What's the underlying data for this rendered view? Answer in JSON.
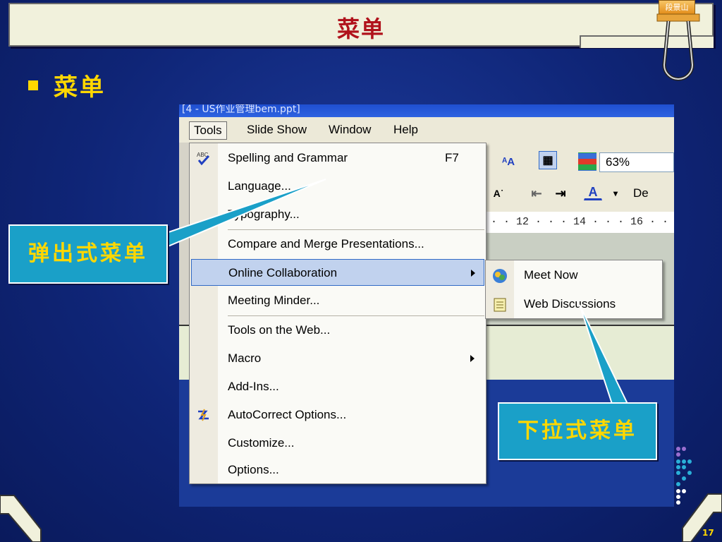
{
  "slide": {
    "title": "菜单",
    "badge": "段景山",
    "bullet": "菜单",
    "page_number": "17"
  },
  "callouts": {
    "popup": "弹出式菜单",
    "dropdown": "下拉式菜单"
  },
  "screenshot": {
    "window_title": "[4 - US作业管理bem.ppt]",
    "menubar": [
      "Tools",
      "Slide Show",
      "Window",
      "Help"
    ],
    "active_menu": "Tools",
    "zoom": "63%",
    "design_label": "De",
    "ruler_text": "· · 12 · · · 14 · · · 16 · · ·",
    "tools_menu": [
      {
        "label": "Spelling and Grammar",
        "shortcut": "F7",
        "icon": "spellcheck-icon"
      },
      {
        "label": "Language...",
        "shortcut": "",
        "icon": ""
      },
      {
        "label": "Typography...",
        "shortcut": "",
        "icon": ""
      },
      {
        "label": "Compare and Merge Presentations...",
        "shortcut": "",
        "icon": ""
      },
      {
        "label": "Online Collaboration",
        "shortcut": "",
        "icon": "",
        "submenu": true
      },
      {
        "label": "Meeting Minder...",
        "shortcut": "",
        "icon": ""
      },
      {
        "label": "Tools on the Web...",
        "shortcut": "",
        "icon": ""
      },
      {
        "label": "Macro",
        "shortcut": "",
        "icon": "",
        "submenu": true
      },
      {
        "label": "Add-Ins...",
        "shortcut": "",
        "icon": ""
      },
      {
        "label": "AutoCorrect Options...",
        "shortcut": "",
        "icon": "autocorrect-icon"
      },
      {
        "label": "Customize...",
        "shortcut": "",
        "icon": ""
      },
      {
        "label": "Options...",
        "shortcut": "",
        "icon": ""
      }
    ],
    "submenu": [
      {
        "label": "Meet Now",
        "icon": "netmeeting-icon"
      },
      {
        "label": "Web Discussions",
        "icon": "web-discussions-icon"
      }
    ]
  },
  "colors": {
    "background": "#0f2577",
    "title_text": "#b0121b",
    "accent_yellow": "#ffd700",
    "callout_fill": "#1aa0c8",
    "menu_highlight": "#c1d2ee"
  }
}
